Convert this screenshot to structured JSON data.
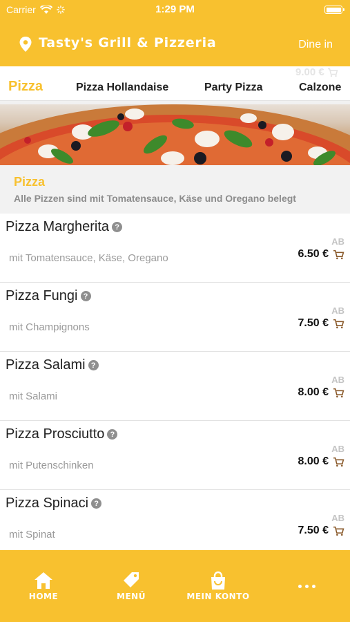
{
  "status": {
    "carrier": "Carrier",
    "time": "1:29 PM"
  },
  "header": {
    "title": "Tasty's Grill & Pizzeria",
    "mode": "Dine in"
  },
  "tabs": {
    "active": "Pizza",
    "items": [
      "Pizza Hollandaise",
      "Party Pizza",
      "Calzone"
    ],
    "ghost_price": "9.00 €"
  },
  "section": {
    "name": "Pizza",
    "description": "Alle Pizzen sind mit Tomatensauce, Käse und Oregano belegt"
  },
  "menu_items": [
    {
      "name": "Pizza Margherita",
      "description": "mit Tomatensauce, Käse, Oregano",
      "from_label": "AB",
      "price": "6.50 €"
    },
    {
      "name": "Pizza Fungi",
      "description": "mit Champignons",
      "from_label": "AB",
      "price": "7.50 €"
    },
    {
      "name": "Pizza Salami",
      "description": "mit Salami",
      "from_label": "AB",
      "price": "8.00 €"
    },
    {
      "name": "Pizza Prosciutto",
      "description": "mit Putenschinken",
      "from_label": "AB",
      "price": "8.00 €"
    },
    {
      "name": "Pizza Spinaci",
      "description": "mit Spinat",
      "from_label": "AB",
      "price": "7.50 €"
    }
  ],
  "bottom_nav": {
    "home": "HOME",
    "menu": "MENÜ",
    "account": "MEIN KONTO"
  },
  "icons": {
    "location": "location-pin-icon",
    "cart": "cart-icon",
    "help": "question-icon",
    "home": "home-icon",
    "menu": "tag-icon",
    "account": "shopping-bag-icon",
    "more": "more-dots-icon"
  },
  "colors": {
    "accent": "#f8c12f",
    "text": "#222222",
    "muted": "#9a9a9a",
    "cart": "#8a5a2b"
  }
}
